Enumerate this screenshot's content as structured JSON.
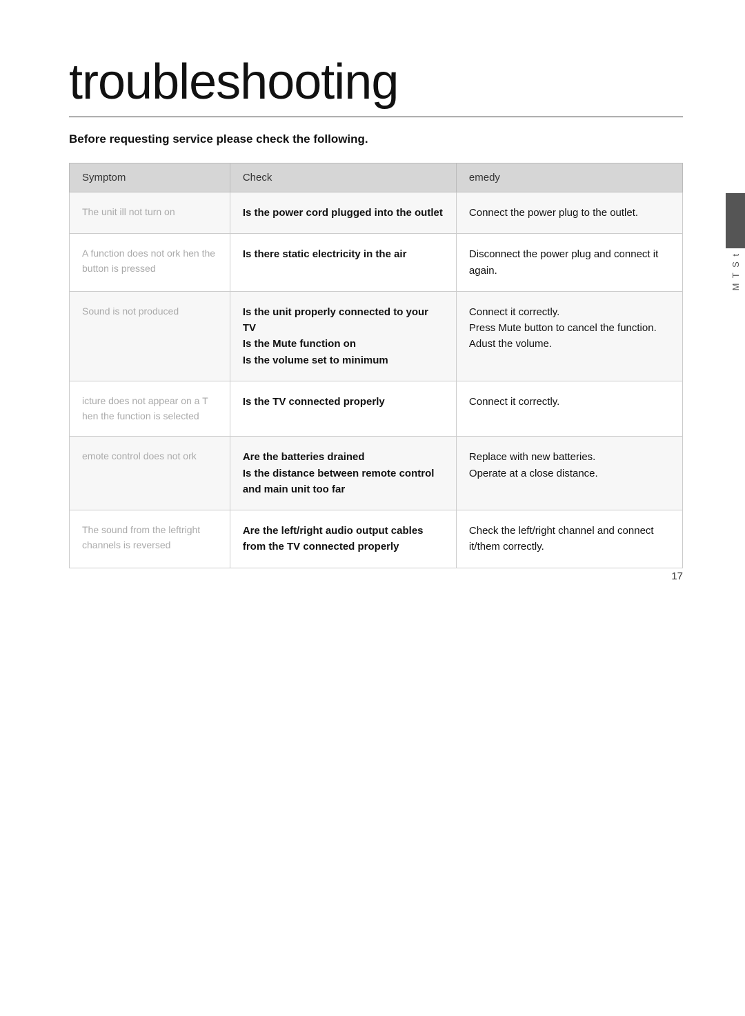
{
  "page": {
    "title": "troubleshooting",
    "subtitle": "Before requesting service please check the following.",
    "page_number": "17",
    "side_tabs": [
      "M",
      "T",
      "S",
      "t"
    ]
  },
  "table": {
    "headers": [
      "Symptom",
      "Check",
      "emedy"
    ],
    "rows": [
      {
        "symptom": "The unit ill  not turn on",
        "check": "Is the power cord plugged into the outlet",
        "remedy": "Connect the power plug to the outlet."
      },
      {
        "symptom": "A function  does not ork  hen the button  is pressed",
        "check": "Is there static electricity in the air",
        "remedy": "Disconnect the power plug and connect it again."
      },
      {
        "symptom": "Sound  is not produced",
        "check": "Is the unit properly connected to your TV\nIs the Mute function on\nIs the volume set to minimum",
        "remedy": "Connect it correctly.\nPress Mute button to cancel the function.\nAdust the volume."
      },
      {
        "symptom": "icture  does not appear on a T\nhen  the function  is selected",
        "check": "Is the TV connected properly",
        "remedy": "Connect it correctly."
      },
      {
        "symptom": "emote  control  does not ork",
        "check": "Are the batteries drained\nIs the distance between remote control and main unit too far",
        "remedy": "Replace with new batteries.\nOperate at a close distance."
      },
      {
        "symptom": "The sound  from  the leftright channels  is reversed",
        "check": "Are the left/right audio output cables from the TV connected properly",
        "remedy": "Check the  left/right channel and connect it/them correctly."
      }
    ]
  }
}
